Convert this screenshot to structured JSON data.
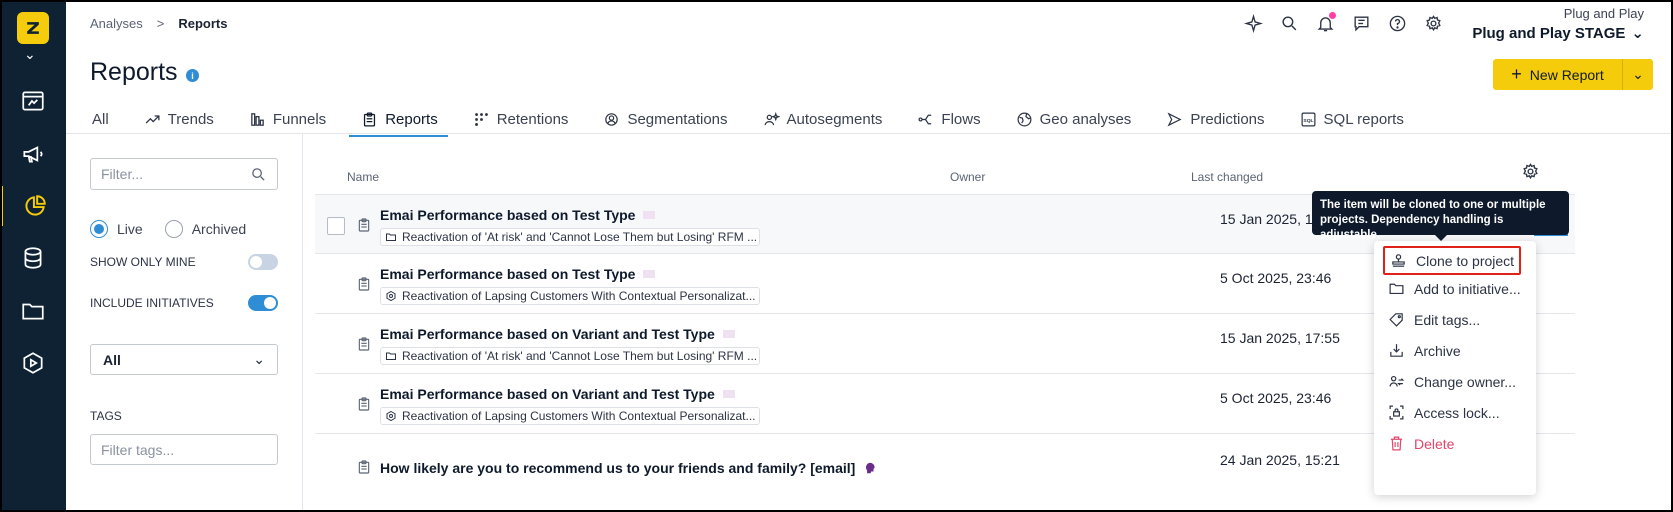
{
  "breadcrumb": {
    "parent": "Analyses",
    "separator": ">",
    "current": "Reports"
  },
  "project": {
    "org": "Plug and Play",
    "name": "Plug and Play STAGE"
  },
  "page": {
    "title": "Reports"
  },
  "new_report": {
    "label": "New Report",
    "plus": "+",
    "caret": "⌄"
  },
  "tabs": [
    {
      "label": "All",
      "icon": ""
    },
    {
      "label": "Trends",
      "icon": "trend-icon"
    },
    {
      "label": "Funnels",
      "icon": "funnel-icon"
    },
    {
      "label": "Reports",
      "icon": "clipboard-icon",
      "active": true
    },
    {
      "label": "Retentions",
      "icon": "grid-dots-icon"
    },
    {
      "label": "Segmentations",
      "icon": "gear-people-icon"
    },
    {
      "label": "Autosegments",
      "icon": "people-spark-icon"
    },
    {
      "label": "Flows",
      "icon": "flow-icon"
    },
    {
      "label": "Geo analyses",
      "icon": "globe-icon"
    },
    {
      "label": "Predictions",
      "icon": "prediction-icon"
    },
    {
      "label": "SQL reports",
      "icon": "sql-icon"
    }
  ],
  "filter": {
    "placeholder": "Filter...",
    "status_options": [
      "Live",
      "Archived"
    ],
    "status_selected": "Live",
    "show_only_mine_label": "SHOW ONLY MINE",
    "show_only_mine": false,
    "include_initiatives_label": "INCLUDE INITIATIVES",
    "include_initiatives": true,
    "initiative_select": "All",
    "tags_label": "TAGS",
    "tags_placeholder": "Filter tags..."
  },
  "table": {
    "columns": {
      "name": "Name",
      "owner": "Owner",
      "last_changed": "Last changed"
    },
    "rows": [
      {
        "title": "Emai Performance based on Test Type",
        "chip": "Reactivation of 'At risk' and 'Cannot Lose Them but Losing' RFM ...",
        "chip_icon": "folder-icon",
        "date": "15 Jan 2025, 17:26"
      },
      {
        "title": "Emai Performance based on Test Type",
        "chip": "Reactivation of Lapsing Customers With Contextual Personalizat...",
        "chip_icon": "hexagon-icon",
        "date": "5 Oct 2025, 23:46"
      },
      {
        "title": "Emai Performance based on Variant and Test Type",
        "chip": "Reactivation of 'At risk' and 'Cannot Lose Them but Losing' RFM ...",
        "chip_icon": "folder-icon",
        "date": "15 Jan 2025, 17:55"
      },
      {
        "title": "Emai Performance based on Variant and Test Type",
        "chip": "Reactivation of Lapsing Customers With Contextual Personalizat...",
        "chip_icon": "hexagon-icon",
        "date": "5 Oct 2025, 23:46"
      },
      {
        "title": "How likely are you to recommend us to your friends and family? [email]",
        "chip": "",
        "chip_icon": "",
        "date": "24 Jan 2025, 15:21"
      }
    ]
  },
  "tooltip": {
    "text": "The item will be cloned to one or multiple projects. Dependency handling is adjustable."
  },
  "context_menu": [
    {
      "label": "Clone to project",
      "icon": "clone-icon"
    },
    {
      "label": "Add to initiative...",
      "icon": "folder-icon"
    },
    {
      "label": "Edit tags...",
      "icon": "tag-icon"
    },
    {
      "label": "Archive",
      "icon": "archive-icon"
    },
    {
      "label": "Change owner...",
      "icon": "change-owner-icon"
    },
    {
      "label": "Access lock...",
      "icon": "lock-icon"
    },
    {
      "label": "Delete",
      "icon": "trash-icon"
    }
  ],
  "colors": {
    "nav_bg": "#0e2233",
    "accent_yellow": "#f5cc0c",
    "accent_blue": "#2f8dd6",
    "danger": "#e0456a",
    "highlight_box": "#e0211a"
  }
}
